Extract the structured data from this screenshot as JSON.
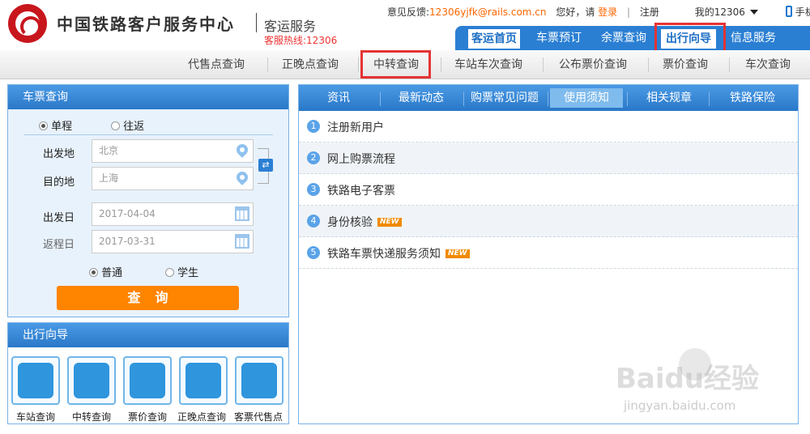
{
  "header": {
    "title": "中国铁路客户服务中心",
    "subtitle": "客运服务",
    "hotline": "客服热线:12306",
    "feedback_label": "意见反馈:",
    "feedback_email": "12306yjfk@rails.com.cn",
    "greeting": "您好，请",
    "login": "登录",
    "register": "注册",
    "my12306": "我的12306",
    "mobile": "手机版"
  },
  "mainnav": {
    "items": [
      "客运首页",
      "车票预订",
      "余票查询",
      "出行向导",
      "信息服务"
    ],
    "active": "出行向导"
  },
  "subnav": {
    "items": [
      "代售点查询",
      "正晚点查询",
      "中转查询",
      "车站车次查询",
      "公布票价查询",
      "票价查询",
      "车次查询"
    ]
  },
  "ticket": {
    "title": "车票查询",
    "trip_single": "单程",
    "trip_round": "往返",
    "from_label": "出发地",
    "from_placeholder": "北京",
    "to_label": "目的地",
    "to_placeholder": "上海",
    "depart_label": "出发日",
    "depart_date": "2017-04-04",
    "return_label": "返程日",
    "return_date": "2017-03-31",
    "type_normal": "普通",
    "type_student": "学生",
    "query_button": "查询"
  },
  "guide": {
    "title": "出行向导",
    "items": [
      {
        "label": "车站查询",
        "icon": "station-icon"
      },
      {
        "label": "中转查询",
        "icon": "transfer-icon"
      },
      {
        "label": "票价查询",
        "icon": "fare-search-icon"
      },
      {
        "label": "正晚点查询",
        "icon": "clock-icon"
      },
      {
        "label": "客票代售点",
        "icon": "ticket-agency-icon"
      }
    ]
  },
  "info": {
    "tabs": [
      "资讯",
      "最新动态",
      "购票常见问题",
      "使用须知",
      "相关规章",
      "铁路保险"
    ],
    "active_tab": "使用须知",
    "rows": [
      {
        "num": "1",
        "text": "注册新用户",
        "new": false
      },
      {
        "num": "2",
        "text": "网上购票流程",
        "new": false
      },
      {
        "num": "3",
        "text": "铁路电子客票",
        "new": false
      },
      {
        "num": "4",
        "text": "身份核验",
        "new": true
      },
      {
        "num": "5",
        "text": "铁路车票快递服务须知",
        "new": true
      }
    ],
    "new_badge": "NEW"
  },
  "watermark": {
    "main": "Baidu经验",
    "sub": "jingyan.baidu.com"
  },
  "colors": {
    "brand_red": "#c8161d",
    "nav_blue": "#2b7fd3",
    "accent_orange": "#ff8400",
    "highlight_red": "#e53333"
  }
}
